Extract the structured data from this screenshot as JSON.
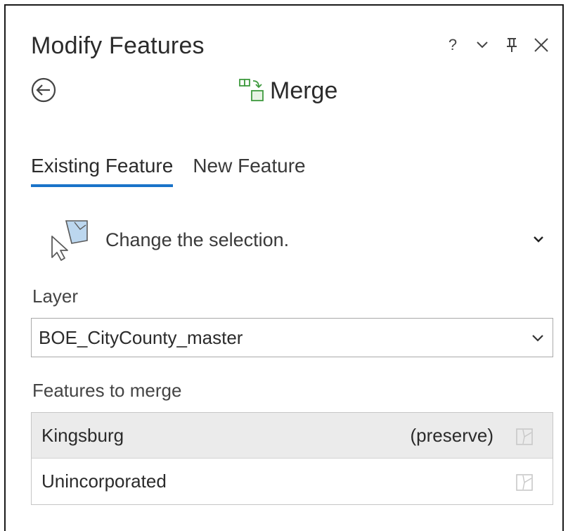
{
  "pane": {
    "title": "Modify Features",
    "controls": {
      "help": "?",
      "options_icon": "chevron-down-icon",
      "pin_icon": "pin-icon",
      "close_icon": "close-icon"
    }
  },
  "tool": {
    "back_icon": "back-arrow-icon",
    "icon": "merge-icon",
    "name": "Merge"
  },
  "tabs": [
    {
      "label": "Existing Feature",
      "active": true
    },
    {
      "label": "New Feature",
      "active": false
    }
  ],
  "selection": {
    "icon": "select-features-icon",
    "text": "Change the selection."
  },
  "layer": {
    "label": "Layer",
    "value": "BOE_CityCounty_master"
  },
  "features": {
    "label": "Features to merge",
    "items": [
      {
        "name": "Kingsburg",
        "tag": "(preserve)",
        "selected": true
      },
      {
        "name": "Unincorporated",
        "tag": "",
        "selected": false
      }
    ]
  },
  "colors": {
    "accent": "#1a73c9",
    "merge_icon": "#3f9a3f",
    "selected_row": "#ebebeb"
  }
}
